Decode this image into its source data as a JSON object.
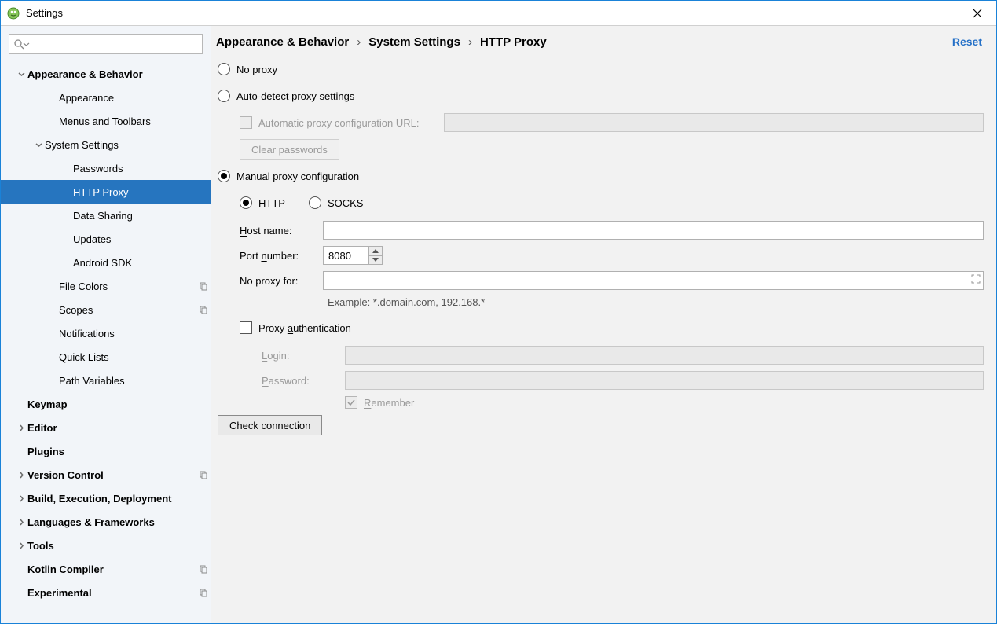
{
  "window": {
    "title": "Settings"
  },
  "sidebar": {
    "items": [
      {
        "label": "Appearance & Behavior",
        "bold": true,
        "indent": 1,
        "arrow": "down"
      },
      {
        "label": "Appearance",
        "indent": 2
      },
      {
        "label": "Menus and Toolbars",
        "indent": 2
      },
      {
        "label": "System Settings",
        "indent": 2,
        "arrow": "down"
      },
      {
        "label": "Passwords",
        "indent": 3
      },
      {
        "label": "HTTP Proxy",
        "indent": 3,
        "selected": true
      },
      {
        "label": "Data Sharing",
        "indent": 3
      },
      {
        "label": "Updates",
        "indent": 3
      },
      {
        "label": "Android SDK",
        "indent": 3
      },
      {
        "label": "File Colors",
        "indent": 2,
        "copy": true
      },
      {
        "label": "Scopes",
        "indent": 2,
        "copy": true
      },
      {
        "label": "Notifications",
        "indent": 2
      },
      {
        "label": "Quick Lists",
        "indent": 2
      },
      {
        "label": "Path Variables",
        "indent": 2
      },
      {
        "label": "Keymap",
        "bold": true,
        "indent": 1,
        "arrow": "none"
      },
      {
        "label": "Editor",
        "bold": true,
        "indent": 1,
        "arrow": "right"
      },
      {
        "label": "Plugins",
        "bold": true,
        "indent": 1,
        "arrow": "none"
      },
      {
        "label": "Version Control",
        "bold": true,
        "indent": 1,
        "arrow": "right",
        "copy": true
      },
      {
        "label": "Build, Execution, Deployment",
        "bold": true,
        "indent": 1,
        "arrow": "right"
      },
      {
        "label": "Languages & Frameworks",
        "bold": true,
        "indent": 1,
        "arrow": "right"
      },
      {
        "label": "Tools",
        "bold": true,
        "indent": 1,
        "arrow": "right"
      },
      {
        "label": "Kotlin Compiler",
        "bold": true,
        "indent": 1,
        "arrow": "none",
        "copy": true
      },
      {
        "label": "Experimental",
        "bold": true,
        "indent": 1,
        "arrow": "none",
        "copy": true
      }
    ]
  },
  "breadcrumb": {
    "seg1": "Appearance & Behavior",
    "seg2": "System Settings",
    "seg3": "HTTP Proxy",
    "reset_label": "Reset"
  },
  "proxy": {
    "no_proxy": "No proxy",
    "auto_detect": "Auto-detect proxy settings",
    "auto_url": "Automatic proxy configuration URL:",
    "clear_passwords": "Clear passwords",
    "manual": "Manual proxy configuration",
    "http": "HTTP",
    "socks": "SOCKS",
    "host": "Host name:",
    "host_hotkey": "H",
    "port": "Port number:",
    "port_hotkey": "n",
    "port_value": "8080",
    "noproxyfor": "No proxy for:",
    "example": "Example: *.domain.com, 192.168.*",
    "auth": "Proxy authentication",
    "auth_hotkey": "a",
    "login": "Login:",
    "login_hotkey": "L",
    "password": "Password:",
    "password_hotkey": "P",
    "remember": "Remember",
    "remember_hotkey": "R",
    "check": "Check connection"
  }
}
